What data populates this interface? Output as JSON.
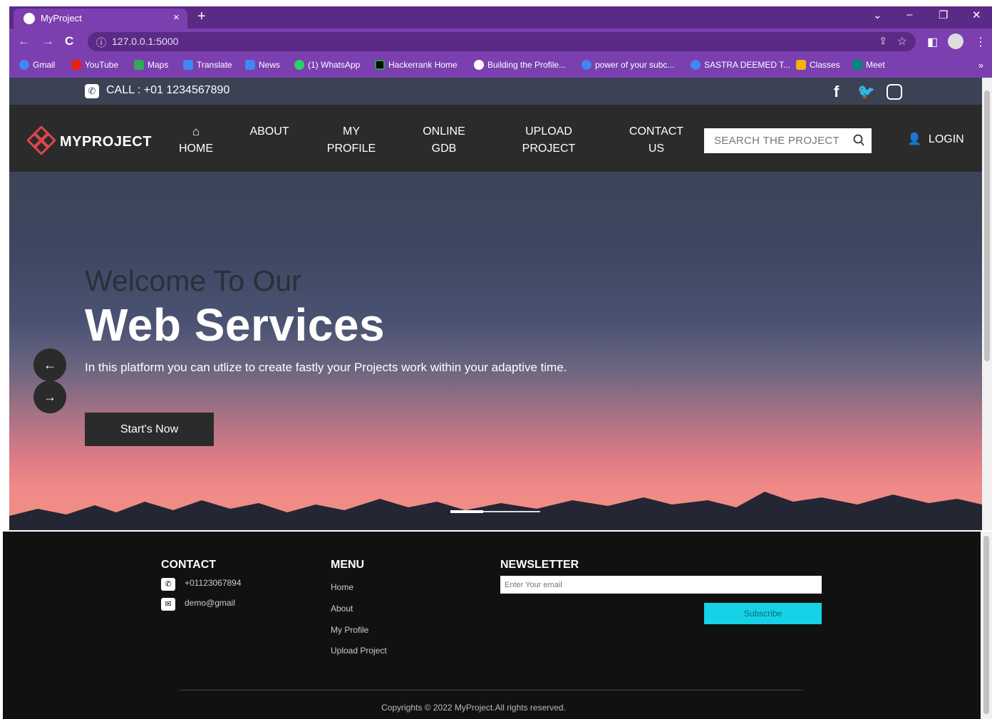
{
  "browser": {
    "tab_title": "MyProject",
    "tab_close": "×",
    "new_tab": "+",
    "url": "127.0.0.1:5000",
    "win_controls": [
      "⌄",
      "–",
      "❐",
      "✕"
    ],
    "bookmarks": [
      {
        "label": "Gmail",
        "icon": "google-icon",
        "color": "#4285f4"
      },
      {
        "label": "YouTube",
        "icon": "youtube-icon",
        "color": "#e62117"
      },
      {
        "label": "Maps",
        "icon": "maps-icon",
        "color": "#34a853"
      },
      {
        "label": "Translate",
        "icon": "translate-icon",
        "color": "#4285f4"
      },
      {
        "label": "News",
        "icon": "news-icon",
        "color": "#4285f4"
      },
      {
        "label": "(1) WhatsApp",
        "icon": "whatsapp-icon",
        "color": "#25d366"
      },
      {
        "label": "Hackerrank Home",
        "icon": "hackerrank-icon",
        "color": "#1ba94c"
      },
      {
        "label": "Building the Profile...",
        "icon": "globe-icon",
        "color": "#ffffff"
      },
      {
        "label": "power of your subc...",
        "icon": "google-icon",
        "color": "#4285f4"
      },
      {
        "label": "SASTRA DEEMED T...",
        "icon": "google-icon",
        "color": "#4285f4"
      },
      {
        "label": "Classes",
        "icon": "classroom-icon",
        "color": "#f4b400"
      },
      {
        "label": "Meet",
        "icon": "meet-icon",
        "color": "#00897b"
      }
    ],
    "more": "»"
  },
  "site": {
    "call": "CALL : +01 1234567890",
    "brand": "MYPROJECT",
    "menu": [
      {
        "line1": "HOME",
        "line2": ""
      },
      {
        "line1": "ABOUT",
        "line2": ""
      },
      {
        "line1": "MY",
        "line2": "PROFILE"
      },
      {
        "line1": "ONLINE",
        "line2": "GDB"
      },
      {
        "line1": "UPLOAD",
        "line2": "PROJECT"
      },
      {
        "line1": "CONTACT",
        "line2": "US"
      }
    ],
    "search_placeholder": "SEARCH THE PROJECT",
    "login": "LOGIN",
    "hero": {
      "welcome": "Welcome To Our",
      "headline": "Web Services",
      "subtitle": "In this platform you can utlize to create fastly your Projects work within your adaptive time.",
      "cta": "Start's Now"
    }
  },
  "footer": {
    "contact_heading": "CONTACT",
    "phone": "+01123067894",
    "email": "demo@gmail",
    "menu_heading": "MENU",
    "menu_items": [
      "Home",
      "About",
      "My Profile",
      "Upload Project"
    ],
    "newsletter_heading": "NEWSLETTER",
    "email_placeholder": "Enter Your email",
    "subscribe": "Subscribe",
    "copyright": "Copyrights © 2022 MyProject.All rights reserved."
  }
}
